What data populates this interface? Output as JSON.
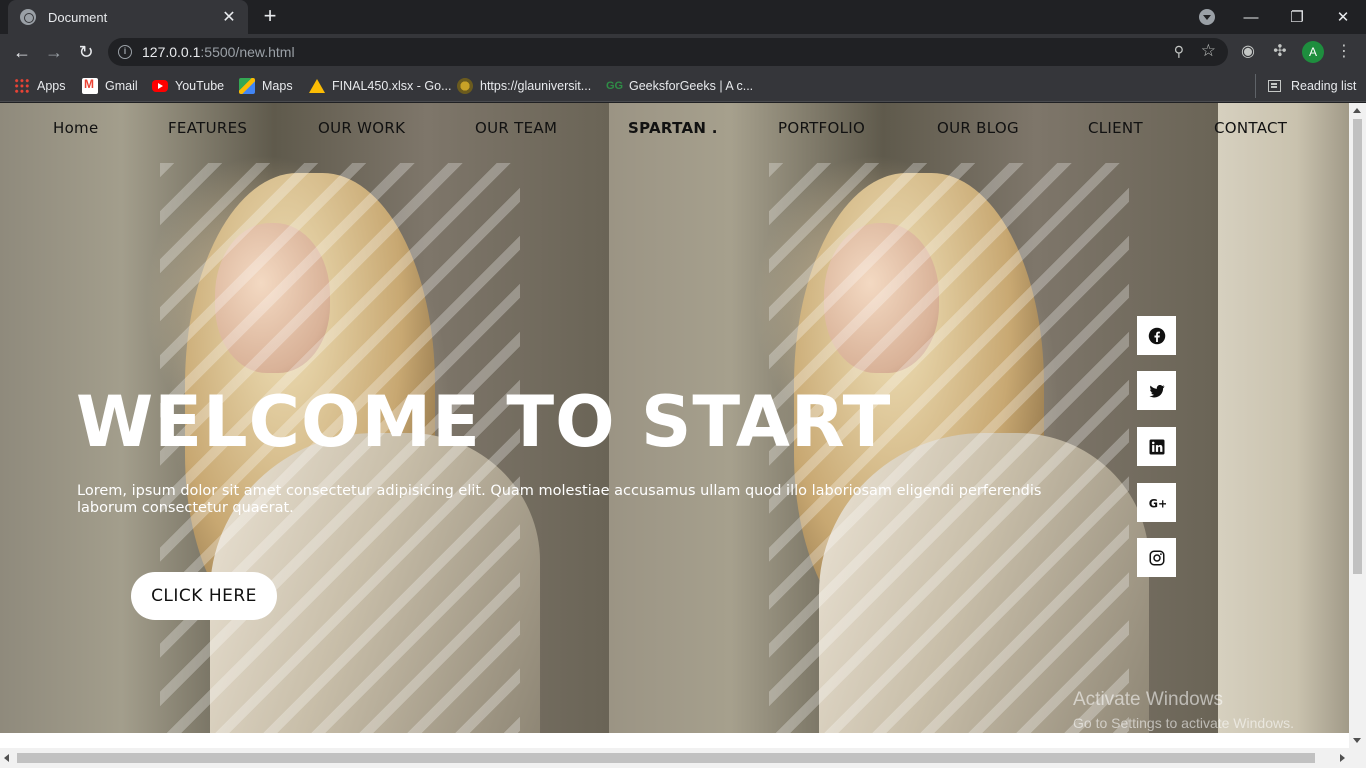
{
  "browser": {
    "tab_title": "Document",
    "url_host": "127.0.0.1",
    "url_rest": ":5500/new.html",
    "bookmarks": [
      "Apps",
      "Gmail",
      "YouTube",
      "Maps",
      "FINAL450.xlsx - Go...",
      "https://glauniversit...",
      "GeeksforGeeks | A c..."
    ],
    "reading_list": "Reading list",
    "profile_initial": "A"
  },
  "nav": {
    "items": [
      "Home",
      "FEATURES",
      "OUR WORK",
      "OUR TEAM",
      "SPARTAN .",
      "PORTFOLIO",
      "OUR BLOG",
      "CLIENT",
      "CONTACT"
    ]
  },
  "hero": {
    "title": "WELCOME TO START",
    "text": "Lorem, ipsum dolor sit amet consectetur adipisicing elit. Quam molestiae accusamus ullam quod illo laboriosam eligendi perferendis laborum consectetur quaerat.",
    "button": "CLICK HERE"
  },
  "social": [
    "facebook-icon",
    "twitter-icon",
    "linkedin-icon",
    "google-plus-icon",
    "instagram-icon"
  ],
  "watermark": {
    "line1": "Activate Windows",
    "line2": "Go to Settings to activate Windows."
  }
}
